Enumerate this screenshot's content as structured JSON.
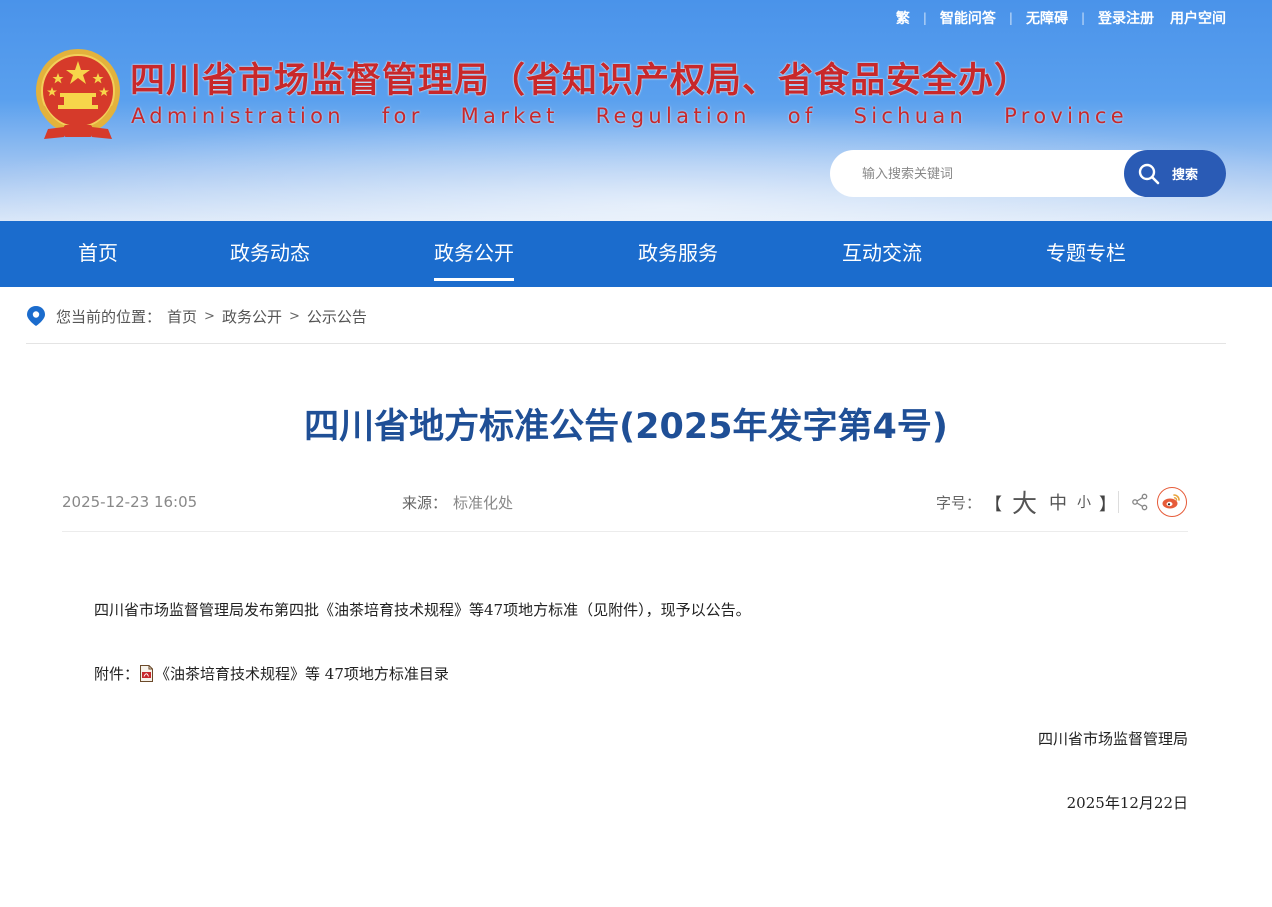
{
  "top_links": {
    "traditional": "繁",
    "smart_qa": "智能问答",
    "accessibility": "无障碍",
    "login_register": "登录注册",
    "user_space": "用户空间",
    "separator": "|"
  },
  "site": {
    "title_cn": "四川省市场监督管理局（省知识产权局、省食品安全办）",
    "title_en_words": [
      "Administration",
      "for",
      "Market",
      "Regulation",
      "of",
      "Sichuan",
      "Province"
    ]
  },
  "search": {
    "placeholder": "输入搜索关键词",
    "button_label": "搜索"
  },
  "nav": {
    "items": [
      "首页",
      "政务动态",
      "政务公开",
      "政务服务",
      "互动交流",
      "专题专栏"
    ],
    "active_index": 2
  },
  "breadcrumb": {
    "prefix": "您当前的位置：",
    "items": [
      "首页",
      "政务公开",
      "公示公告"
    ],
    "sep": ">"
  },
  "article": {
    "title": "四川省地方标准公告(2025年发字第4号)",
    "datetime": "2025-12-23 16:05",
    "source_label": "来源：",
    "source": "标准化处",
    "font_label": "字号：",
    "bracket_open": "【",
    "bracket_close": "】",
    "size_large": "大",
    "size_medium": "中",
    "size_small": "小",
    "body": "四川省市场监督管理局发布第四批《油茶培育技术规程》等47项地方标准（见附件），现予以公告。",
    "attachment_label": "附件：",
    "attachment_name": "《油茶培育技术规程》等 47项地方标准目录",
    "signature": "四川省市场监督管理局",
    "sign_date": "2025年12月22日"
  },
  "colors": {
    "brand_red": "#c8282b",
    "nav_blue": "#1b6ccd",
    "title_blue": "#1f4f96",
    "search_button": "#2a5bb5",
    "weibo_orange": "#e65c3a"
  },
  "icons": {
    "emblem": "national-emblem",
    "search": "search-icon",
    "location": "location-pin-icon",
    "share": "share-icon",
    "weibo": "weibo-icon",
    "pdf": "pdf-file-icon"
  }
}
